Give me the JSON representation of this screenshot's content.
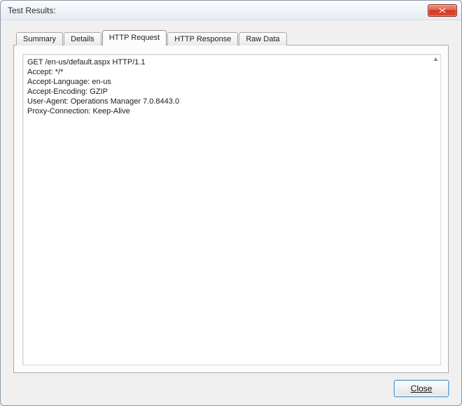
{
  "window": {
    "title": "Test Results:"
  },
  "tabs": {
    "items": [
      {
        "label": "Summary",
        "active": false
      },
      {
        "label": "Details",
        "active": false
      },
      {
        "label": "HTTP Request",
        "active": true
      },
      {
        "label": "HTTP Response",
        "active": false
      },
      {
        "label": "Raw Data",
        "active": false
      }
    ]
  },
  "content": {
    "http_request": "GET /en-us/default.aspx HTTP/1.1\nAccept: */*\nAccept-Language: en-us\nAccept-Encoding: GZIP\nUser-Agent: Operations Manager 7.0.8443.0\nProxy-Connection: Keep-Alive"
  },
  "footer": {
    "close_label": "Close"
  }
}
